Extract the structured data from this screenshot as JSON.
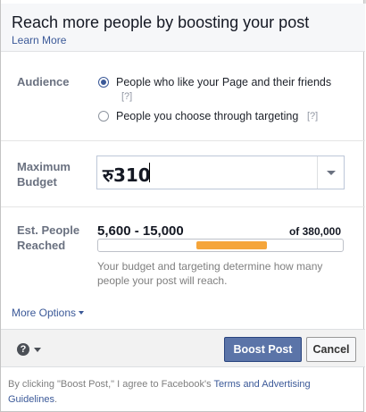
{
  "header": {
    "title": "Reach more people by boosting your post",
    "learn_more": "Learn More"
  },
  "audience": {
    "label": "Audience",
    "options": [
      {
        "text": "People who like your Page and their friends",
        "help": "[?]",
        "selected": true
      },
      {
        "text": "People you choose through targeting",
        "help": "[?]",
        "selected": false
      }
    ]
  },
  "budget": {
    "label": "Maximum Budget",
    "value": "रु310"
  },
  "reach": {
    "label": "Est. People Reached",
    "range": "5,600 - 15,000",
    "total": "of 380,000",
    "fill_start_fraction": 0.4,
    "fill_end_fraction": 0.69,
    "bar_color": "#f5a53a",
    "hint": "Your budget and targeting determine how many people your post will reach."
  },
  "more_options": "More Options",
  "footer": {
    "help_icon": "question-icon",
    "boost_label": "Boost Post",
    "cancel_label": "Cancel"
  },
  "legal": {
    "prefix": "By clicking \"Boost Post,\" I agree to Facebook's ",
    "link": "Terms and Advertising Guidelines",
    "suffix": "."
  },
  "colors": {
    "accent": "#3b5998",
    "boost_button": "#5b74a8"
  }
}
